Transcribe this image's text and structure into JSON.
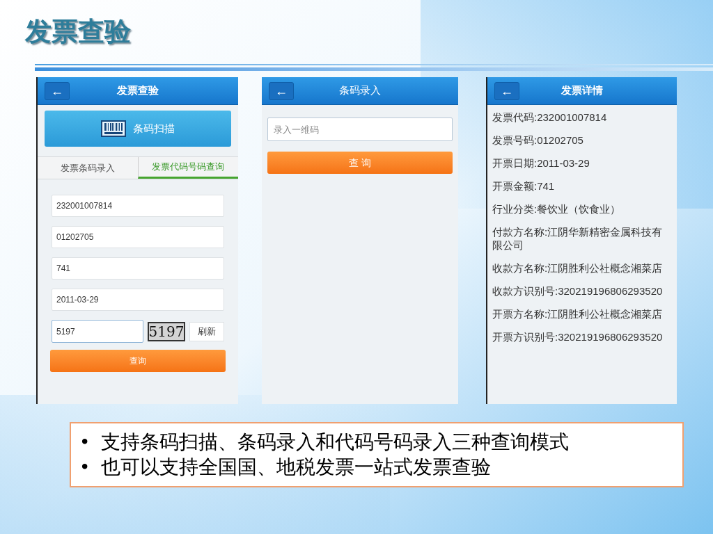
{
  "slide": {
    "title": "发票查验"
  },
  "query_screen": {
    "header": {
      "back": "←",
      "title": "发票查验"
    },
    "scan_button": "条码扫描",
    "tabs": [
      {
        "label": "发票条码录入",
        "selected": false
      },
      {
        "label": "发票代码号码查询",
        "selected": true
      }
    ],
    "fields": [
      "232001007814",
      "01202705",
      "741",
      "2011-03-29"
    ],
    "captcha": {
      "value": "5197",
      "image_text": "5197",
      "refresh": "刷新"
    },
    "query_button": "查询"
  },
  "entry_screen": {
    "header": {
      "back": "←",
      "title": "条码录入"
    },
    "placeholder": "录入一维码",
    "query_button": "查 询"
  },
  "detail_screen": {
    "header": {
      "back": "←",
      "title": "发票详情"
    },
    "lines": [
      "发票代码:232001007814",
      "发票号码:01202705",
      "开票日期:2011-03-29",
      "开票金额:741",
      "行业分类:餐饮业（饮食业）",
      "付款方名称:江阴华新精密金属科技有限公司",
      "收款方名称:江阴胜利公社概念湘菜店",
      "收款方识别号:320219196806293520",
      "开票方名称:江阴胜利公社概念湘菜店",
      "开票方识别号:320219196806293520"
    ]
  },
  "bullets": [
    {
      "marker": "•",
      "text": "支持条码扫描、条码录入和代码号码录入三种查询模式"
    },
    {
      "marker": "•",
      "text": "也可以支持全国国、地税发票一站式发票查验"
    }
  ]
}
